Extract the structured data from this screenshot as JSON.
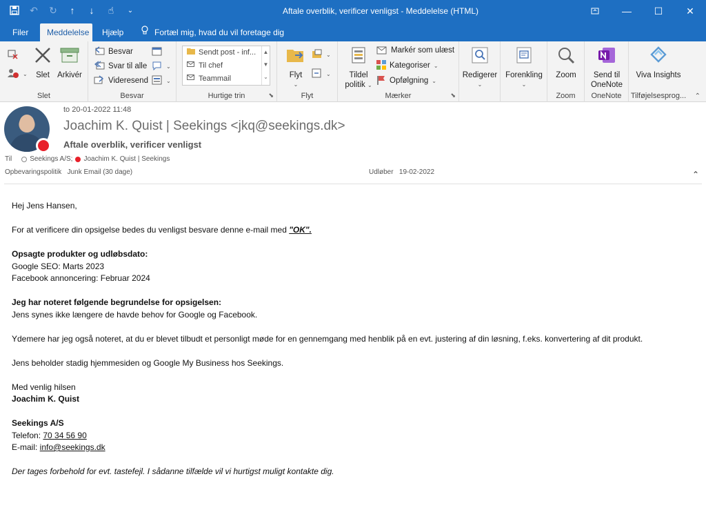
{
  "titlebar": {
    "title": "Aftale overblik, verificer venligst  -  Meddelelse (HTML)"
  },
  "tabs": [
    {
      "label": "Filer"
    },
    {
      "label": "Meddelelse"
    },
    {
      "label": "Hjælp"
    }
  ],
  "tellme": "Fortæl mig, hvad du vil foretage dig",
  "ribbon": {
    "slet": {
      "label": "Slet",
      "delete": "Slet",
      "archive": "Arkivér"
    },
    "besvar": {
      "label": "Besvar",
      "reply": "Besvar",
      "reply_all": "Svar til alle",
      "forward": "Videresend"
    },
    "quick": {
      "label": "Hurtige trin",
      "items": [
        "Sendt post - inf...",
        "Til chef",
        "Teammail"
      ]
    },
    "flyt": {
      "label": "Flyt",
      "move": "Flyt"
    },
    "maerker": {
      "label": "Mærker",
      "assign": "Tildel politik",
      "unread": "Markér som ulæst",
      "categorize": "Kategoriser",
      "followup": "Opfølgning"
    },
    "edit": {
      "label": "Redigerer"
    },
    "immersive": {
      "label": "Forenkling"
    },
    "zoom": {
      "label": "Zoom",
      "button": "Zoom"
    },
    "onenote": {
      "label": "OneNote",
      "button": "Send til OneNote"
    },
    "addins": {
      "label": "Tilføjelsesprog...",
      "button": "Viva Insights"
    }
  },
  "header": {
    "date": "to 20-01-2022 11:48",
    "sender": "Joachim K. Quist | Seekings <jkq@seekings.dk>",
    "subject": "Aftale overblik, verificer venligst",
    "to_label": "Til",
    "to_1": "Seekings A/S;",
    "to_2": "Joachim K. Quist | Seekings",
    "policy": "Opbevaringspolitik   Junk Email (30 dage)",
    "expires": "Udløber   19-02-2022"
  },
  "body": {
    "greeting": "Hej Jens Hansen,",
    "verify_pre": "For at verificere din opsigelse bedes du venligst besvare denne e-mail med ",
    "verify_ok": "\"OK\".",
    "products_heading": "Opsagte produkter og udløbsdato:",
    "product_1": "Google SEO: Marts 2023",
    "product_2": "Facebook annoncering: Februar 2024",
    "reason_heading": "Jeg har noteret følgende begrundelse for opsigelsen:",
    "reason": "Jens synes ikke længere de havde behov for Google og Facebook.",
    "meeting": "Ydemere har jeg også noteret, at du er blevet tilbudt et personligt møde for en gennemgang med henblik på en evt. justering af din løsning, f.eks. konvertering af dit produkt.",
    "keeps": "Jens beholder stadig hjemmesiden og Google My Business hos Seekings.",
    "regards": "Med venlig hilsen",
    "signer": "Joachim K. Quist",
    "company": "Seekings A/S",
    "phone_label": "Telefon: ",
    "phone": "70 34 56 90",
    "email_label": "E-mail: ",
    "email": "info@seekings.dk",
    "disclaimer": "Der tages forbehold for evt. tastefejl. I sådanne tilfælde vil vi hurtigst muligt kontakte dig."
  }
}
